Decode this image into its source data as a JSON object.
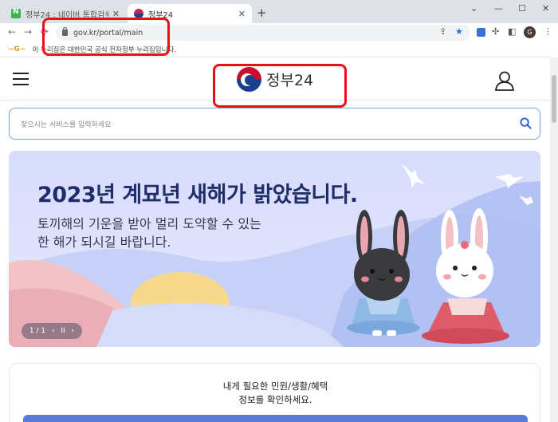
{
  "browser": {
    "tabs": [
      {
        "label": "정부24 : 네이버 통합검색",
        "close": "✕"
      },
      {
        "label": "정부24",
        "close": "✕"
      }
    ],
    "new_tab": "+",
    "window_controls": [
      "⌄",
      "—",
      "☐",
      "✕"
    ],
    "nav": {
      "back": "←",
      "forward": "→",
      "reload": "⟳"
    },
    "url": "gov.kr/portal/main",
    "profile_initial": "G"
  },
  "infobar": {
    "mark": "~G~",
    "text": "이 누리집은 대한민국 공식 전자정부 누리집입니다."
  },
  "header": {
    "logo_text": "정부24"
  },
  "search": {
    "placeholder": "찾으시는 서비스를 입력하세요"
  },
  "banner": {
    "title": "2023년 계묘년 새해가 밝았습니다.",
    "subtitle_line1": "토끼해의 기운을 받아 멀리 도약할 수 있는",
    "subtitle_line2": "한 해가 되시길 바랍니다.",
    "pager": "1 / 1",
    "prev": "‹",
    "pause": "II",
    "next": "›"
  },
  "card": {
    "line1": "내게 필요한 민원/생활/혜택",
    "line2": "정보를 확인하세요."
  },
  "colors": {
    "annotation": "#e8101a",
    "banner_title": "#1f2e6a",
    "search_border": "#7aa0e6",
    "accent_button": "#5a7bd8"
  }
}
